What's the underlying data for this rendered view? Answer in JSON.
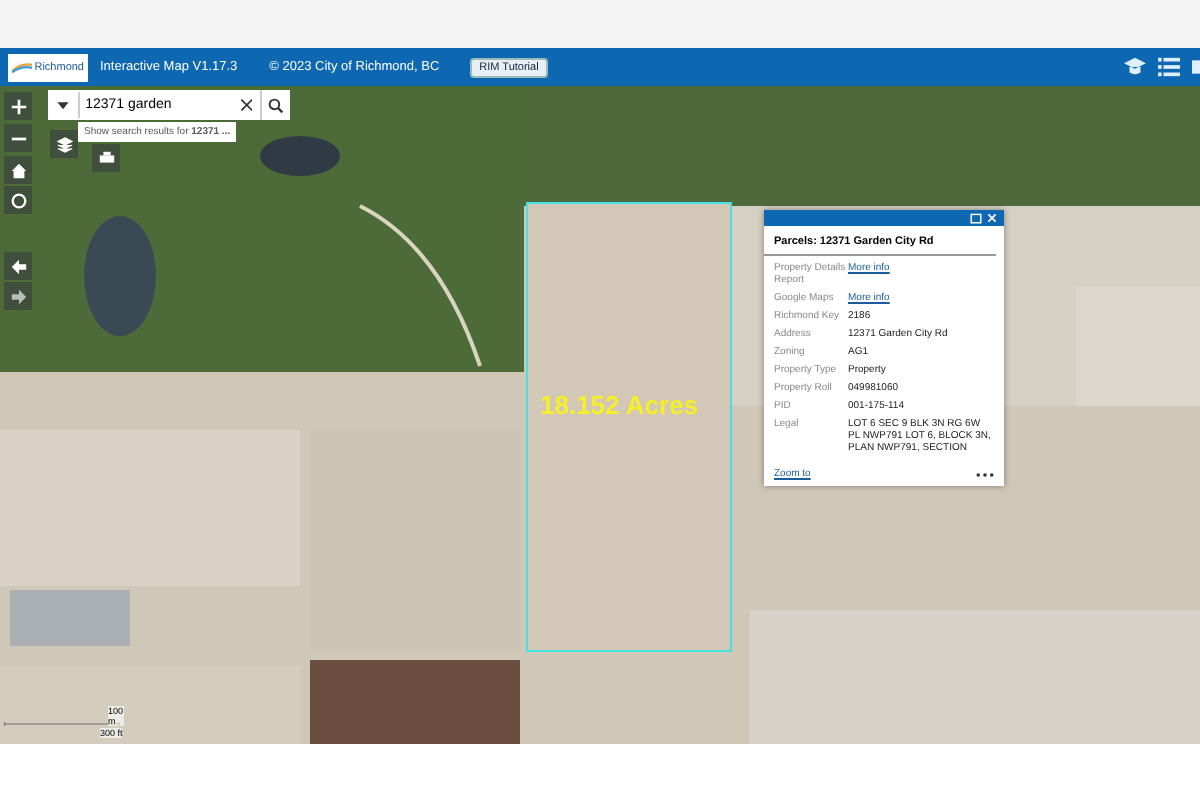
{
  "header": {
    "logo_text": "Richmond",
    "title": "Interactive Map V1.17.3",
    "copyright": "© 2023 City of Richmond, BC",
    "tutorial_button": "RIM Tutorial"
  },
  "search": {
    "value": "12371 garden",
    "suggestion": "Show search results for **12371 ...**"
  },
  "map": {
    "parcel_label": "18.152 Acres",
    "scale_metric": "100 m",
    "scale_imperial": "300 ft"
  },
  "popup": {
    "title": "Parcels: 12371 Garden City Rd",
    "rows": [
      {
        "label": "Property Details Report",
        "value": "More info",
        "kind": "link"
      },
      {
        "label": "Google Maps",
        "value": "More info",
        "kind": "link"
      },
      {
        "label": "Richmond Key",
        "value": "2186",
        "kind": "text"
      },
      {
        "label": "Address",
        "value": "12371 Garden City Rd",
        "kind": "text"
      },
      {
        "label": "Zoning",
        "value": "AG1",
        "kind": "text"
      },
      {
        "label": "Property Type",
        "value": "Property",
        "kind": "text"
      },
      {
        "label": "Property Roll",
        "value": "049981060",
        "kind": "text"
      },
      {
        "label": "PID",
        "value": "001-175-114",
        "kind": "text"
      },
      {
        "label": "Legal",
        "value": "LOT 6 SEC 9 BLK 3N RG 6W PL NWP791 LOT 6, BLOCK 3N, PLAN NWP791, SECTION",
        "kind": "text"
      }
    ],
    "zoom_link": "Zoom to"
  }
}
